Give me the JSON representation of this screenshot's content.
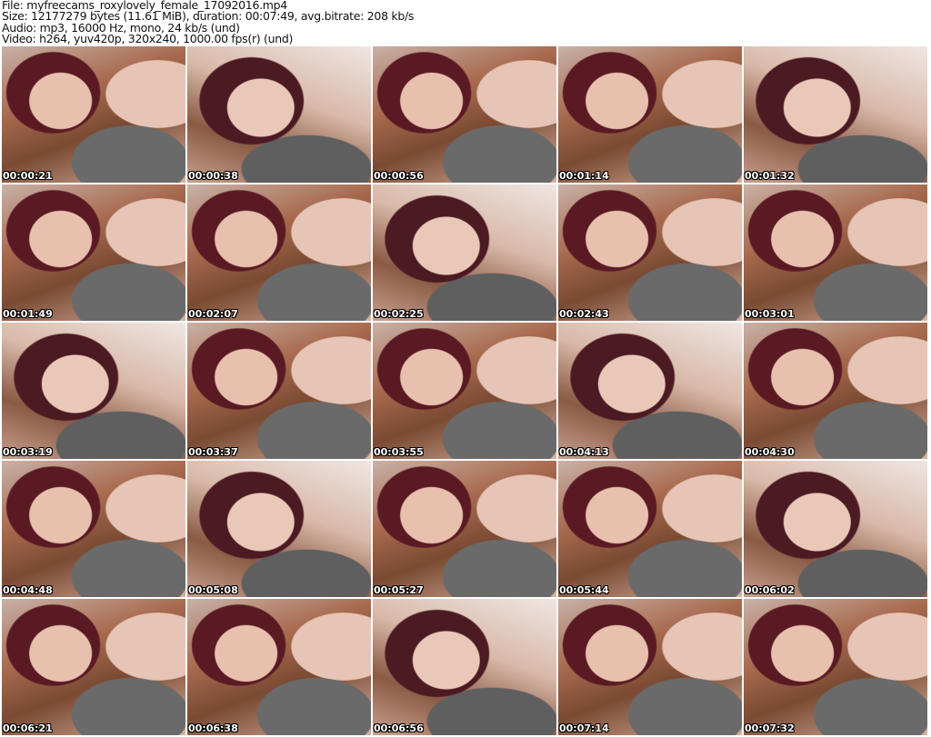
{
  "header": {
    "file": "File: myfreecams_roxylovely_female_17092016.mp4",
    "size": "Size: 12177279 bytes (11.61 MiB), duration: 00:07:49, avg.bitrate: 208 kb/s",
    "audio": "Audio: mp3, 16000 Hz, mono, 24 kb/s (und)",
    "video": "Video: h264, yuv420p, 320x240, 1000.00 fps(r) (und)"
  },
  "thumbnails": [
    "00:00:21",
    "00:00:38",
    "00:00:56",
    "00:01:14",
    "00:01:32",
    "00:01:49",
    "00:02:07",
    "00:02:25",
    "00:02:43",
    "00:03:01",
    "00:03:19",
    "00:03:37",
    "00:03:55",
    "00:04:13",
    "00:04:30",
    "00:04:48",
    "00:05:08",
    "00:05:27",
    "00:05:44",
    "00:06:02",
    "00:06:21",
    "00:06:38",
    "00:06:56",
    "00:07:14",
    "00:07:32"
  ]
}
